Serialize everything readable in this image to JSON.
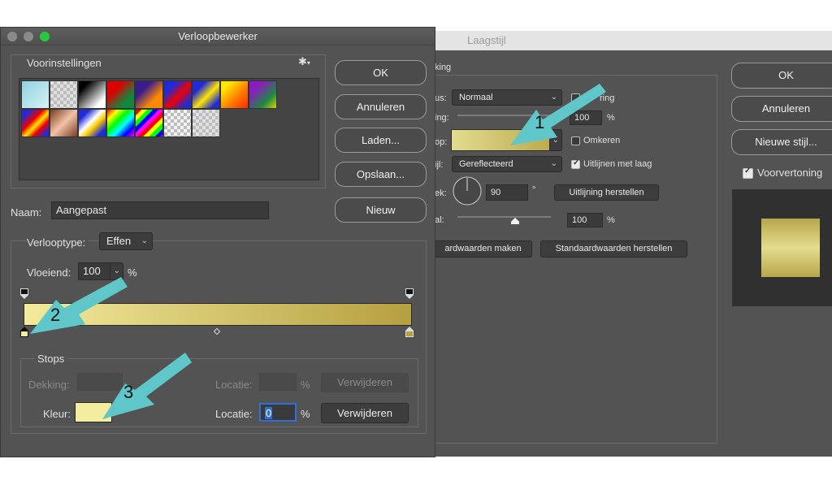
{
  "laagstijl": {
    "title": "Laagstijl",
    "group_label": "king",
    "modus_label": "us:",
    "modus_value": "Normaal",
    "dither_label": "ring",
    "dekking_label": "ing:",
    "dekking_value": "100",
    "percent": "%",
    "verloop_label": "op:",
    "omkeren_label": "Omkeren",
    "stijl_label": "ijl:",
    "stijl_value": "Gereflecteerd",
    "uitlijnen_label": "Uitlijnen met laag",
    "hoek_label": "ek:",
    "hoek_value": "90",
    "degree": "°",
    "uitlijning_button": "Uitlijning herstellen",
    "schaal_label": "al:",
    "schaal_value": "100",
    "standaard_maken": "ardwaarden maken",
    "standaard_herstellen": "Standaardwaarden herstellen",
    "ok": "OK",
    "annuleren": "Annuleren",
    "nieuwe_stijl": "Nieuwe stijl...",
    "voorvertoning": "Voorvertoning",
    "gradient_colors": [
      "#e3dc8e",
      "#b8a64a"
    ]
  },
  "verloop": {
    "title": "Verloopbewerker",
    "presets_label": "Voorinstellingen",
    "gear_icon": "gear-icon",
    "ok": "OK",
    "annuleren": "Annuleren",
    "laden": "Laden...",
    "opslaan": "Opslaan...",
    "naam_label": "Naam:",
    "naam_value": "Aangepast",
    "nieuw": "Nieuw",
    "verlooptype_label": "Verlooptype:",
    "verlooptype_value": "Effen",
    "vloeiend_label": "Vloeiend:",
    "vloeiend_value": "100",
    "percent": "%",
    "stops_label": "Stops",
    "dekking_label": "Dekking:",
    "locatie_label": "Locatie:",
    "verwijderen": "Verwijderen",
    "kleur_label": "Kleur:",
    "locatie_value": "0",
    "gradient_colors": [
      "#f3ea9c",
      "#b5a040"
    ],
    "kleur_color": "#f4ec9e"
  },
  "annotations": {
    "n1": "1",
    "n2": "2",
    "n3": "3",
    "arrow_color": "#5fc7c9"
  }
}
